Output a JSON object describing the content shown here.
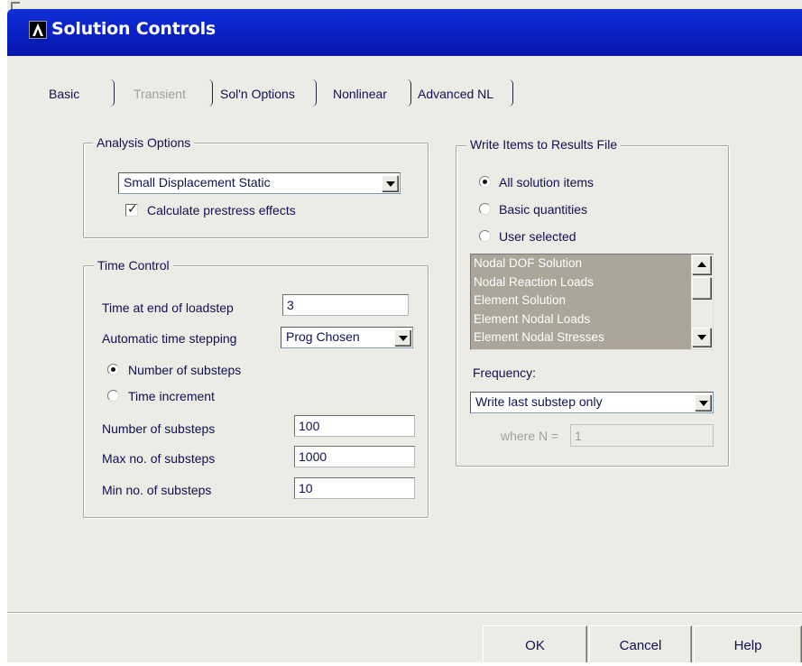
{
  "window": {
    "title": "Solution Controls"
  },
  "tabs": [
    {
      "label": "Basic",
      "enabled": true,
      "active": true
    },
    {
      "label": "Transient",
      "enabled": false,
      "active": false
    },
    {
      "label": "Sol'n Options",
      "enabled": true,
      "active": false
    },
    {
      "label": "Nonlinear",
      "enabled": true,
      "active": false
    },
    {
      "label": "Advanced NL",
      "enabled": true,
      "active": false
    }
  ],
  "analysis_options": {
    "group_label": "Analysis Options",
    "analysis_type": "Small Displacement Static",
    "prestress_label": "Calculate prestress effects",
    "prestress_checked": true
  },
  "time_control": {
    "group_label": "Time Control",
    "end_time_label": "Time at end of loadstep",
    "end_time_value": "3",
    "auto_time_label": "Automatic time stepping",
    "auto_time_value": "Prog Chosen",
    "radio_substeps_label": "Number of substeps",
    "radio_increment_label": "Time increment",
    "selected_mode": "Number of substeps",
    "num_substeps_label": "Number of substeps",
    "num_substeps_value": "100",
    "max_substeps_label": "Max no. of substeps",
    "max_substeps_value": "1000",
    "min_substeps_label": "Min no. of substeps",
    "min_substeps_value": "10"
  },
  "write_items": {
    "group_label": "Write Items to Results File",
    "radio_all_label": "All solution items",
    "radio_basic_label": "Basic quantities",
    "radio_user_label": "User selected",
    "selected": "All solution items",
    "list_items": [
      "Nodal DOF Solution",
      "Nodal Reaction Loads",
      "Element Solution",
      "Element Nodal Loads",
      "Element Nodal Stresses"
    ],
    "frequency_label": "Frequency:",
    "frequency_value": "Write last substep only",
    "where_n_label": "where N =",
    "where_n_value": "1"
  },
  "buttons": {
    "ok": "OK",
    "cancel": "Cancel",
    "help": "Help"
  },
  "colors": {
    "titlebar": "#0a22c8",
    "dialog_bg": "#ecebe6",
    "listbox_bg": "#aba59a",
    "text": "#111152"
  }
}
